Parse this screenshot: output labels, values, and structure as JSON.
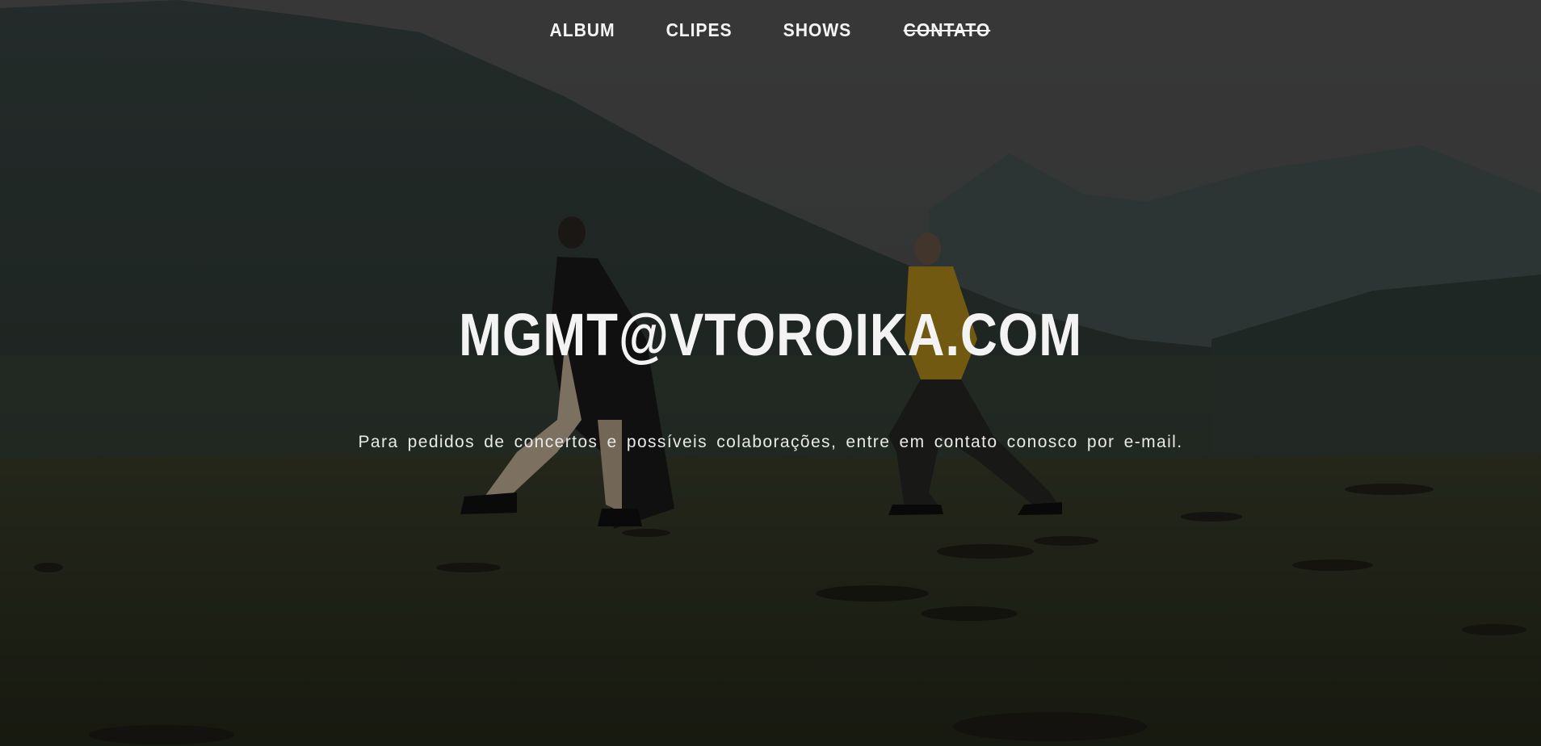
{
  "nav": {
    "items": [
      {
        "label": "ALBUM",
        "active": false
      },
      {
        "label": "CLIPES",
        "active": false
      },
      {
        "label": "SHOWS",
        "active": false
      },
      {
        "label": "CONTATO",
        "active": true
      }
    ]
  },
  "hero": {
    "email": "MGMT@VTOROIKA.COM",
    "tagline": "Para pedidos de concertos e possíveis colaborações, entre em contato conosco por e-mail."
  },
  "colors": {
    "sky": "#4a4a4a",
    "mountains_far": "#3e4848",
    "mountains_near": "#2f3d37",
    "grass": "#2a2f1f",
    "jacket": "#b8901c",
    "text": "#f2f2f2"
  }
}
